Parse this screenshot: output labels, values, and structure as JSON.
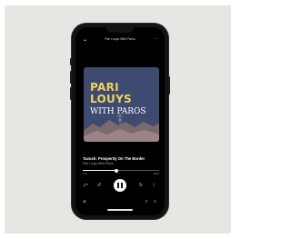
{
  "header": {
    "collapse_icon": "chevron-down-icon",
    "title": "Pari Louys With Paros",
    "more_icon": "more-dots-icon"
  },
  "cover": {
    "line1": "PARI",
    "line2": "LOUYS",
    "line3": "WITH PAROS",
    "colors": {
      "background": "#3f4a71",
      "title": "#f0d35a",
      "subtitle": "#ffffff",
      "mountains": "#7a6a6e"
    }
  },
  "track": {
    "title": "Tavush: Prosperity On The Border",
    "artist": "Pari Louys With Paros",
    "progress_fraction": 0.44,
    "elapsed": "0:21",
    "remaining": "-15:16"
  },
  "controls": {
    "speed_icon": "playback-speed-icon",
    "rewind_icon": "rewind-15-icon",
    "play_state": "paused-button-shown",
    "forward_icon": "forward-15-icon",
    "sleep_icon": "moon-icon"
  },
  "bottom_bar": {
    "devices_icon": "connect-device-icon",
    "share_icon": "share-icon",
    "queue_icon": "queue-icon"
  },
  "colors": {
    "accent": "#ffffff",
    "background": "#000000",
    "page": "#e6e6e2"
  }
}
